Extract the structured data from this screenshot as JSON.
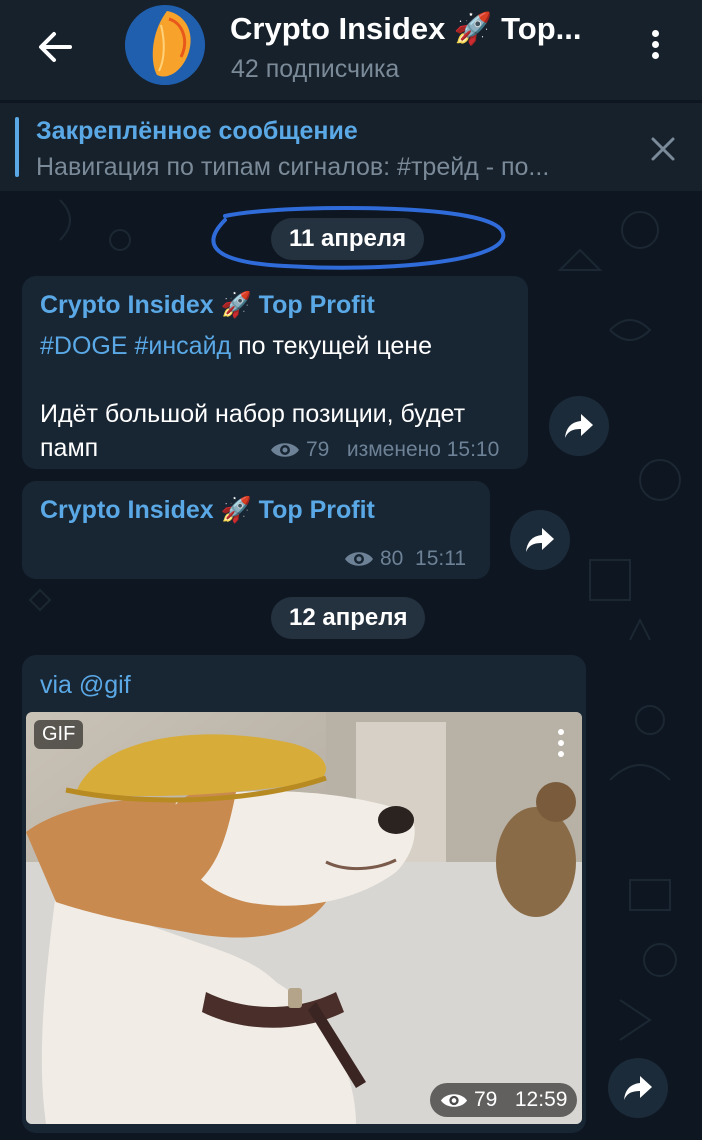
{
  "header": {
    "title": "Crypto Insidex 🚀 Top...",
    "subscribers": "42 подписчика"
  },
  "pinned": {
    "title": "Закреплённое сообщение",
    "text": "Навигация по типам сигналов:   #трейд - по..."
  },
  "dates": {
    "first": "11 апреля",
    "second": "12 апреля"
  },
  "messages": [
    {
      "sender": "Crypto Insidex 🚀 Top Profit",
      "tag1": "#DOGE",
      "tag2": "#инсайд",
      "line1_rest": " по текущей цене",
      "line2": "Идёт большой набор позиции, будет",
      "line3": "памп",
      "views": "79",
      "time": "изменено 15:10"
    },
    {
      "sender": "Crypto Insidex 🚀 Top Profit",
      "views": "80",
      "time": "15:11"
    },
    {
      "via": "via @gif",
      "badge": "GIF",
      "views": "79",
      "time": "12:59"
    }
  ],
  "colors": {
    "accent": "#5aa9e6",
    "background": "#0e1621",
    "bubble": "#182533",
    "header": "#17212b"
  }
}
